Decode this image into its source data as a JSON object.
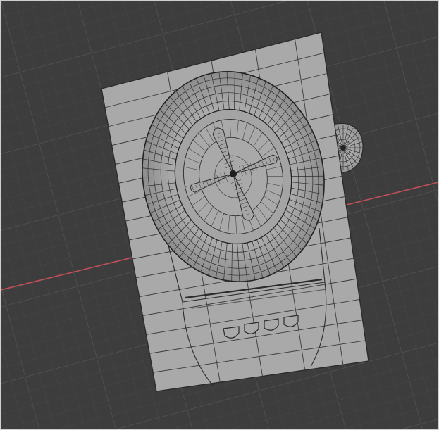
{
  "viewport": {
    "view": "top-orthographic",
    "shading": "wireframe-overlay",
    "background_color": "#3d3d3d",
    "grid_minor_color": "#474747",
    "grid_major_color": "#545454",
    "x_axis_color": "#c25058",
    "mesh_face_color": "#a9a9a9",
    "mesh_edge_color": "#2a2a2a"
  },
  "model": {
    "parts": [
      {
        "name": "base-plate",
        "icon": "plane-mesh"
      },
      {
        "name": "dial-ring",
        "icon": "torus-mesh"
      },
      {
        "name": "blade",
        "icon": "propeller-mesh"
      },
      {
        "name": "side-knob",
        "icon": "sphere-mesh"
      },
      {
        "name": "control-buttons",
        "count": 4
      }
    ]
  }
}
